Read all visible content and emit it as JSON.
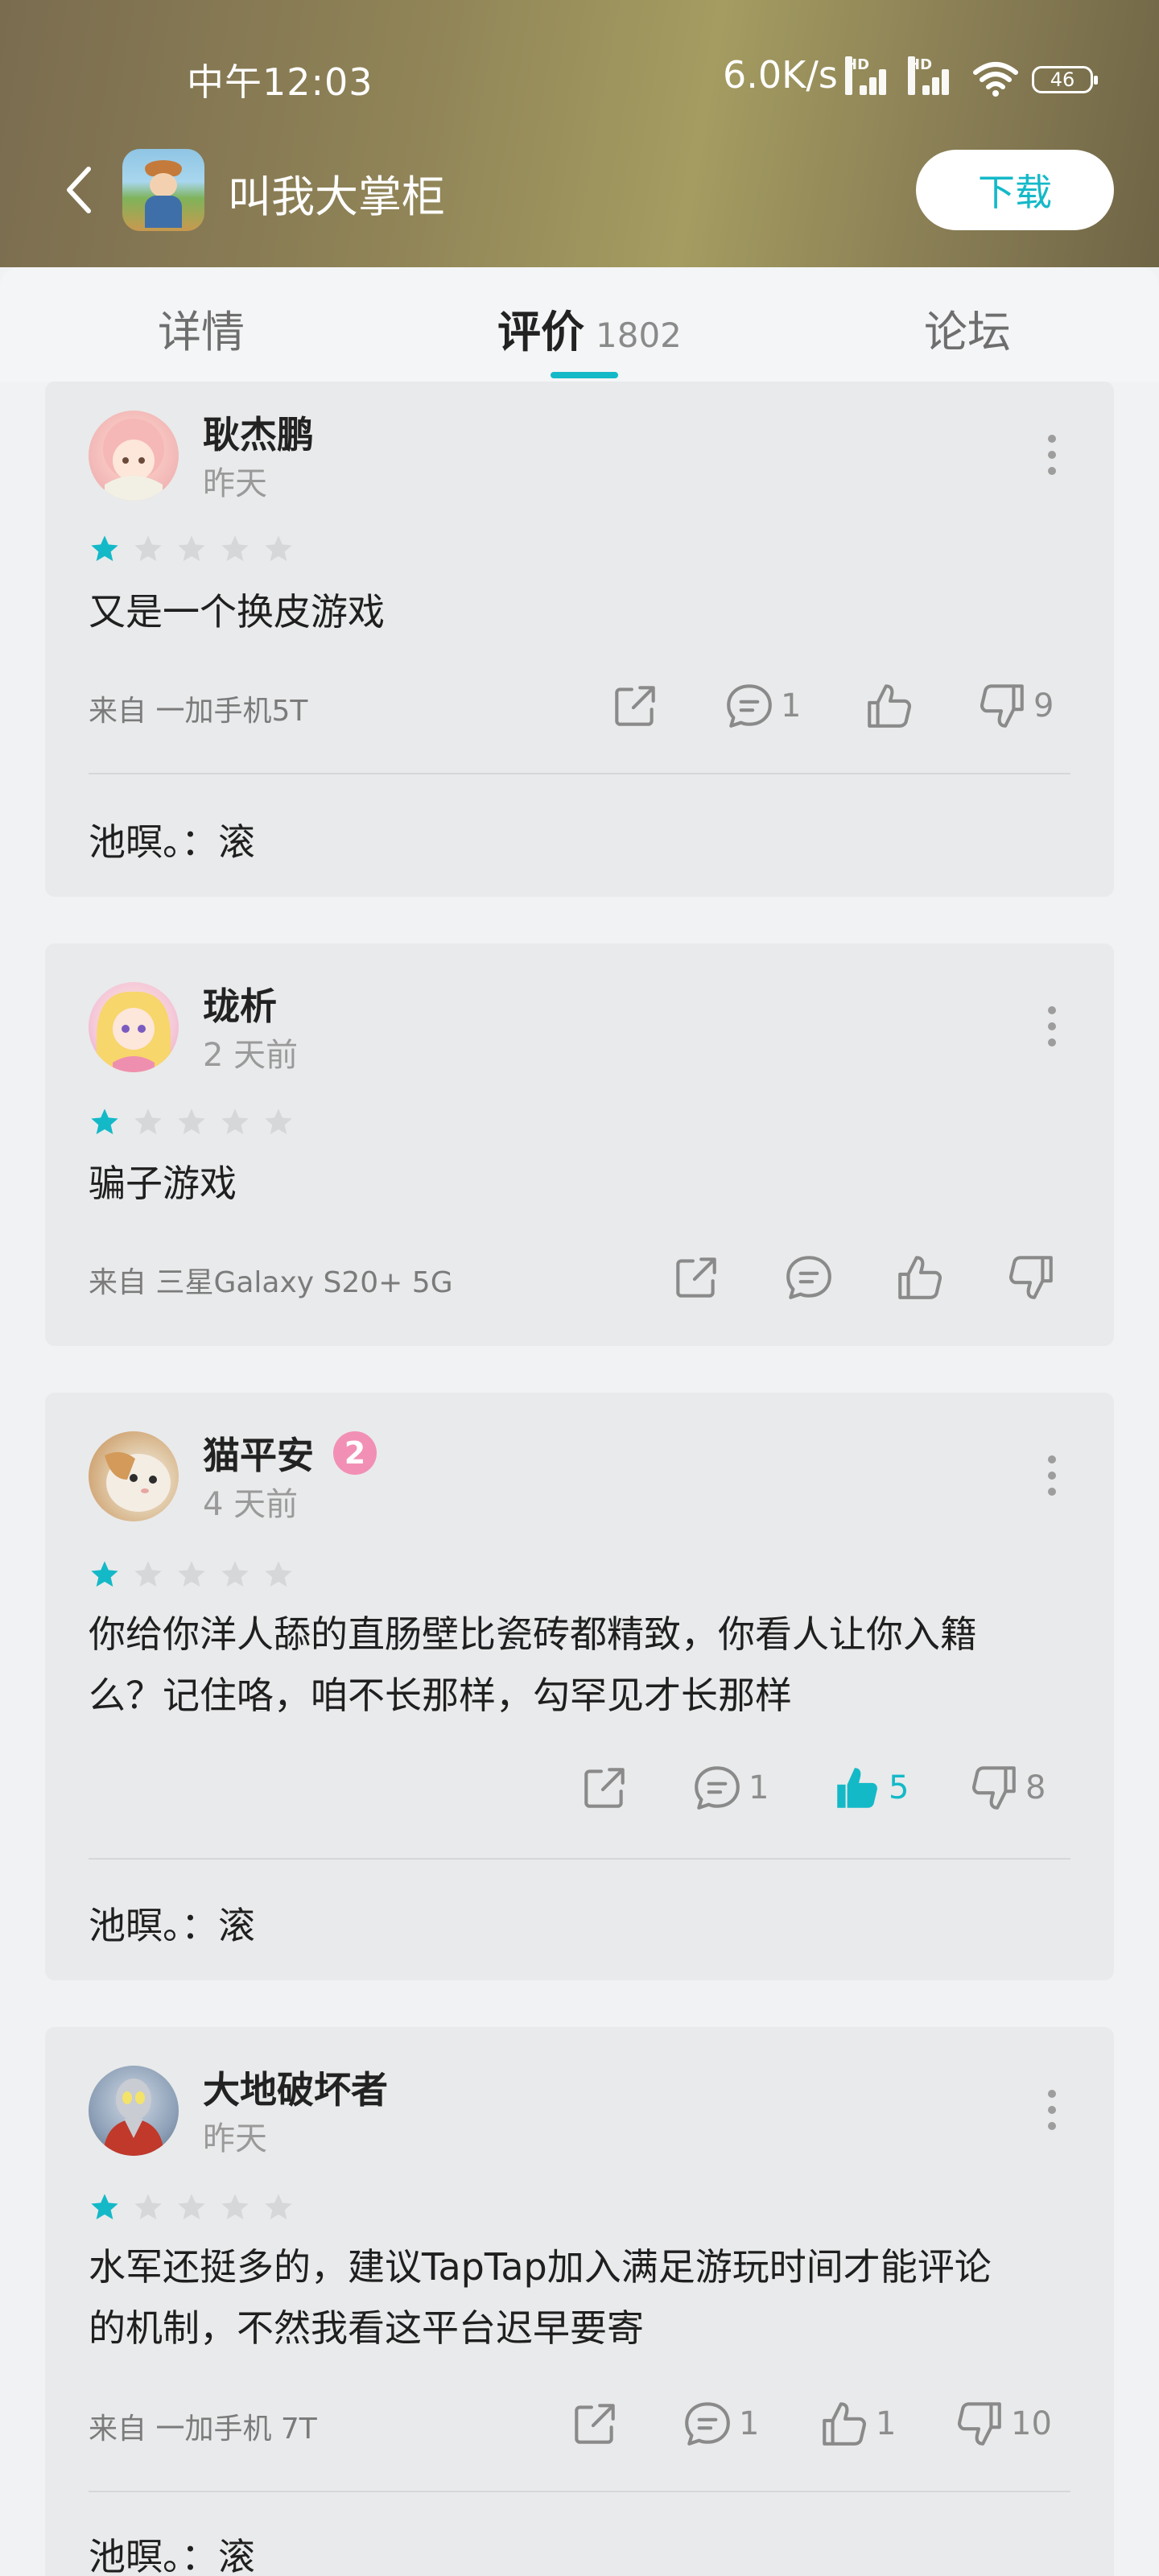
{
  "status_bar": {
    "time": "中午12:03",
    "network_speed": "6.0K/s",
    "signal_tag": "HD",
    "battery": "46"
  },
  "app_header": {
    "app_title": "叫我大掌柜",
    "download_label": "下载"
  },
  "tabs": {
    "details": "详情",
    "reviews": "评价",
    "reviews_count": "1802",
    "forum": "论坛"
  },
  "colors": {
    "accent": "#14b9c8",
    "star_off": "#d5d7d9"
  },
  "reviews": [
    {
      "username": "耿杰鹏",
      "date": "昨天",
      "rating": 1,
      "text": "又是一个换皮游戏",
      "device": "来自 一加手机5T",
      "comments": "1",
      "likes": "",
      "dislikes": "9",
      "reply": "池暝。：滚"
    },
    {
      "username": "珑析",
      "date": "2 天前",
      "rating": 1,
      "text": "骗子游戏",
      "device": "来自 三星Galaxy S20+ 5G",
      "comments": "",
      "likes": "",
      "dislikes": ""
    },
    {
      "username": "猫平安",
      "badge": "2",
      "date": "4 天前",
      "rating": 1,
      "text_line1": "你给你洋人舔的直肠壁比瓷砖都精致，你看人让你入籍",
      "text_line2": "么？记住咯，咱不长那样，勾罕见才长那样",
      "comments": "1",
      "likes": "5",
      "dislikes": "8",
      "reply": "池暝。：滚"
    },
    {
      "username": "大地破坏者",
      "date": "昨天",
      "rating": 1,
      "text_line1": "水军还挺多的，建议TapTap加入满足游玩时间才能评论",
      "text_line2": "的机制，不然我看这平台迟早要寄",
      "device": "来自 一加手机 7T",
      "comments": "1",
      "likes": "1",
      "dislikes": "10",
      "reply": "池暝。：滚"
    }
  ]
}
